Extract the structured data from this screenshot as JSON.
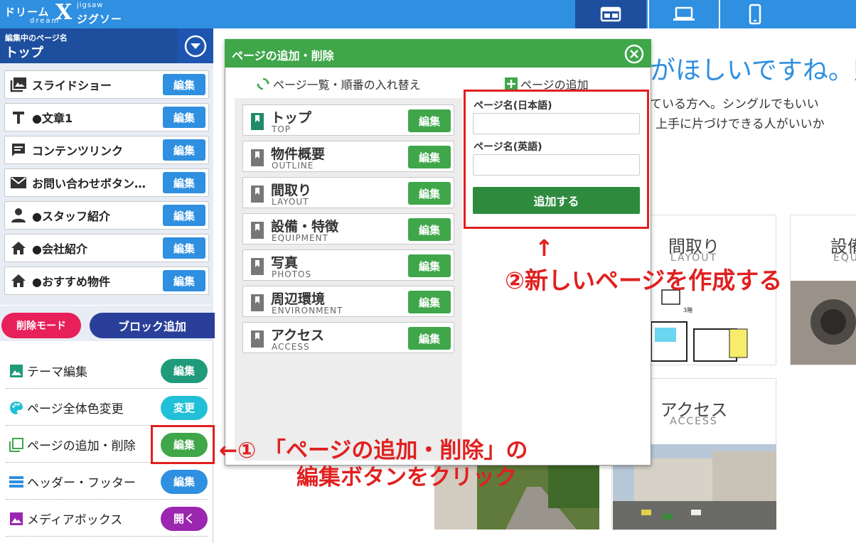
{
  "app": {
    "logo_ja": "ドリーム",
    "logo_x": "X",
    "logo_jigsaw": "jigsaw",
    "logo_jigsaw_ja": "ジグソー",
    "logo_dream": "dream"
  },
  "device_tabs": [
    {
      "icon": "desktop-icon",
      "active": true
    },
    {
      "icon": "laptop-icon",
      "active": false
    },
    {
      "icon": "phone-icon",
      "active": false
    }
  ],
  "sidebar": {
    "page_caption": "編集中のページ名",
    "page_name": "トップ",
    "blocks": [
      {
        "icon": "image-icon",
        "label": "スライドショー",
        "button": "編集"
      },
      {
        "icon": "text-icon",
        "label": "●文章1",
        "button": "編集"
      },
      {
        "icon": "comment-icon",
        "label": "コンテンツリンク",
        "button": "編集"
      },
      {
        "icon": "mail-icon",
        "label": "お問い合わせボタン…",
        "button": "編集"
      },
      {
        "icon": "person-icon",
        "label": "●スタッフ紹介",
        "button": "編集"
      },
      {
        "icon": "home-icon",
        "label": "●会社紹介",
        "button": "編集"
      },
      {
        "icon": "home-icon",
        "label": "●おすすめ物件",
        "button": "編集"
      }
    ],
    "delete_mode": "削除モード",
    "add_block": "ブロック追加",
    "menus": [
      {
        "icon": "theme-icon",
        "label": "テーマ編集",
        "button": "編集",
        "color": "#1f9a7a"
      },
      {
        "icon": "palette-icon",
        "label": "ページ全体色変更",
        "button": "変更",
        "color": "#22c0d8"
      },
      {
        "icon": "pages-icon",
        "label": "ページの追加・削除",
        "button": "編集",
        "color": "#3fa64a"
      },
      {
        "icon": "header-footer-icon",
        "label": "ヘッダー・フッター",
        "button": "編集",
        "color": "#2f8fe0"
      },
      {
        "icon": "media-icon",
        "label": "メディアボックス",
        "button": "開く",
        "color": "#9b27b0"
      }
    ]
  },
  "background": {
    "title": "がほしいですね。販",
    "text1": "ている方へ。シングルでもいい",
    "text2": "上手に片づけできる人がいいか",
    "cards": [
      {
        "title": "間取り",
        "sub": "LAYOUT"
      },
      {
        "title": "設備",
        "sub": "EQU"
      },
      {
        "title": "アクセス",
        "sub": "ACCESS"
      }
    ]
  },
  "modal": {
    "title": "ページの追加・削除",
    "tab_list": "ページ一覧・順番の入れ替え",
    "tab_add": "ページの追加",
    "pages": [
      {
        "ja": "トップ",
        "en": "TOP",
        "button": "編集",
        "active": true
      },
      {
        "ja": "物件概要",
        "en": "OUTLINE",
        "button": "編集",
        "active": false
      },
      {
        "ja": "間取り",
        "en": "LAYOUT",
        "button": "編集",
        "active": false
      },
      {
        "ja": "設備・特徴",
        "en": "EQUIPMENT",
        "button": "編集",
        "active": false
      },
      {
        "ja": "写真",
        "en": "PHOTOS",
        "button": "編集",
        "active": false
      },
      {
        "ja": "周辺環境",
        "en": "ENVIRONMENT",
        "button": "編集",
        "active": false
      },
      {
        "ja": "アクセス",
        "en": "ACCESS",
        "button": "編集",
        "active": false
      }
    ],
    "form": {
      "label_ja": "ページ名(日本語)",
      "value_ja": "",
      "label_en": "ページ名(英語)",
      "value_en": "",
      "submit": "追加する"
    }
  },
  "annotations": {
    "step1_line1": "←① 「ページの追加・削除」の",
    "step1_line2": "編集ボタンをクリック",
    "step2_arrow": "↑",
    "step2": "②新しいページを作成する"
  },
  "colors": {
    "brand_blue": "#2f8fe0",
    "dark_blue": "#1e4f9e",
    "green": "#3fa64a",
    "red_annotation": "#e02020"
  }
}
